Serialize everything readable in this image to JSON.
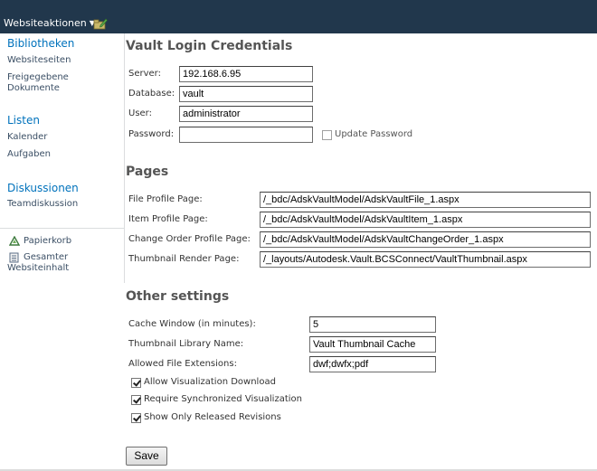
{
  "topbar": {
    "site_actions_label": "Websiteaktionen",
    "edit_icon": "edit-page-icon"
  },
  "nav": {
    "libraries_heading": "Bibliotheken",
    "site_pages": "Websiteseiten",
    "shared_docs_line1": "Freigegebene",
    "shared_docs_line2": "Dokumente",
    "lists_heading": "Listen",
    "calendar": "Kalender",
    "tasks": "Aufgaben",
    "discussions_heading": "Diskussionen",
    "team_discussion": "Teamdiskussion",
    "recycle_bin": "Papierkorb",
    "all_content_line1": "Gesamter",
    "all_content_line2": "Websiteinhalt"
  },
  "login": {
    "title": "Vault Login Credentials",
    "server_label": "Server:",
    "server_value": "192.168.6.95",
    "database_label": "Database:",
    "database_value": "vault",
    "user_label": "User:",
    "user_value": "administrator",
    "password_label": "Password:",
    "password_value": "",
    "update_password_label": "Update Password",
    "update_password_checked": false
  },
  "pages": {
    "title": "Pages",
    "file_profile_label": "File Profile Page:",
    "file_profile_value": "/_bdc/AdskVaultModel/AdskVaultFile_1.aspx",
    "item_profile_label": "Item Profile Page:",
    "item_profile_value": "/_bdc/AdskVaultModel/AdskVaultItem_1.aspx",
    "change_order_label": "Change Order Profile Page:",
    "change_order_value": "/_bdc/AdskVaultModel/AdskVaultChangeOrder_1.aspx",
    "thumbnail_render_label": "Thumbnail Render Page:",
    "thumbnail_render_value": "/_layouts/Autodesk.Vault.BCSConnect/VaultThumbnail.aspx"
  },
  "other": {
    "title": "Other settings",
    "cache_window_label": "Cache Window (in minutes):",
    "cache_window_value": "5",
    "thumb_library_label": "Thumbnail Library Name:",
    "thumb_library_value": "Vault Thumbnail Cache",
    "allowed_ext_label": "Allowed File Extensions:",
    "allowed_ext_value": "dwf;dwfx;pdf",
    "allow_viz_download_label": "Allow Visualization Download",
    "allow_viz_download_checked": true,
    "require_sync_label": "Require Synchronized Visualization",
    "require_sync_checked": true,
    "only_released_label": "Show Only Released Revisions",
    "only_released_checked": true
  },
  "actions": {
    "save_label": "Save"
  }
}
